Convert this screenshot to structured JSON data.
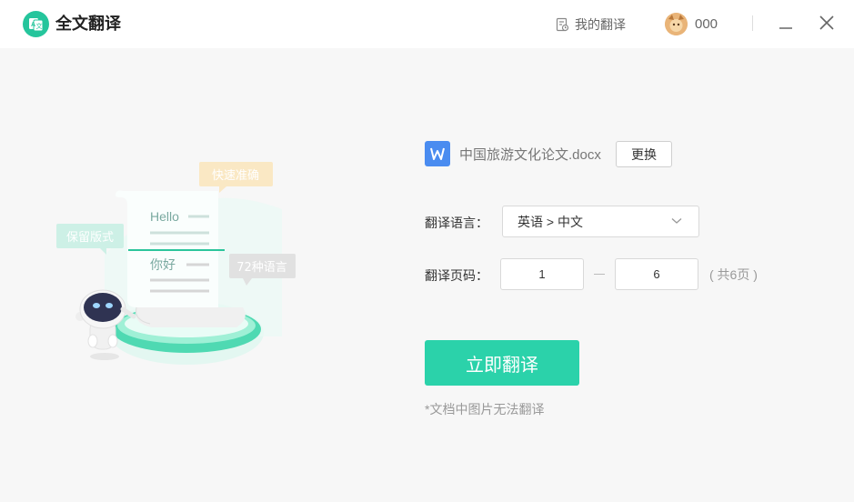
{
  "app": {
    "title": "全文翻译"
  },
  "header": {
    "my_translations": "我的翻译",
    "username": "000"
  },
  "file": {
    "name": "中国旅游文化论文.docx",
    "change_label": "更换"
  },
  "form": {
    "language_label": "翻译语言：",
    "language_value": "英语 > 中文",
    "pages_label": "翻译页码：",
    "page_from": "1",
    "page_to": "6",
    "total_pages": "( 共6页 )"
  },
  "actions": {
    "translate_label": "立即翻译",
    "note": "*文档中图片无法翻译"
  },
  "illustration": {
    "bubble_fast": "快速准确",
    "bubble_format": "保留版式",
    "bubble_languages": "72种语言",
    "doc_hello": "Hello",
    "doc_nihao": "你好"
  },
  "colors": {
    "accent": "#2bd2aa",
    "logo": "#25c59c",
    "word_icon": "#4a8cf0"
  }
}
